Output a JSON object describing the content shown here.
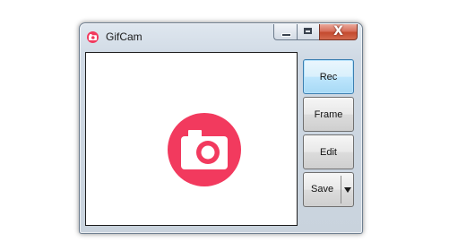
{
  "window": {
    "title": "GifCam",
    "close_glyph": "X"
  },
  "buttons": {
    "rec": "Rec",
    "frame": "Frame",
    "edit": "Edit",
    "save": "Save"
  },
  "icons": {
    "app": "camera-icon",
    "capture": "camera-icon",
    "save_dropdown": "chevron-down-icon"
  },
  "colors": {
    "accent": "#f23a5e",
    "rec_highlight": "#a7d9f5"
  }
}
